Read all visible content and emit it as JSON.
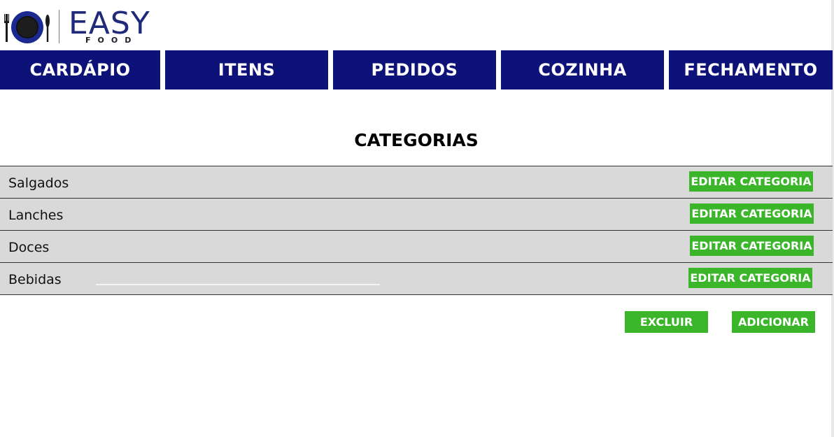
{
  "logo": {
    "word": "EASY",
    "sub": "FOOD",
    "icon": "plate-fork-knife-icon"
  },
  "nav": {
    "tabs": [
      {
        "label": "CARDÁPIO"
      },
      {
        "label": "ITENS"
      },
      {
        "label": "PEDIDOS"
      },
      {
        "label": "COZINHA"
      },
      {
        "label": "FECHAMENTO"
      }
    ]
  },
  "page": {
    "title": "CATEGORIAS"
  },
  "categories": {
    "edit_label": "EDITAR CATEGORIA",
    "items": [
      {
        "name": "Salgados"
      },
      {
        "name": "Lanches"
      },
      {
        "name": "Doces"
      },
      {
        "name": "Bebidas"
      }
    ]
  },
  "actions": {
    "delete_label": "EXCLUIR",
    "add_label": "ADICIONAR"
  },
  "colors": {
    "nav_bg": "#0c1278",
    "button_green": "#3bb52a",
    "row_bg": "#d9d9d9",
    "logo_blue": "#1f2a7a"
  }
}
